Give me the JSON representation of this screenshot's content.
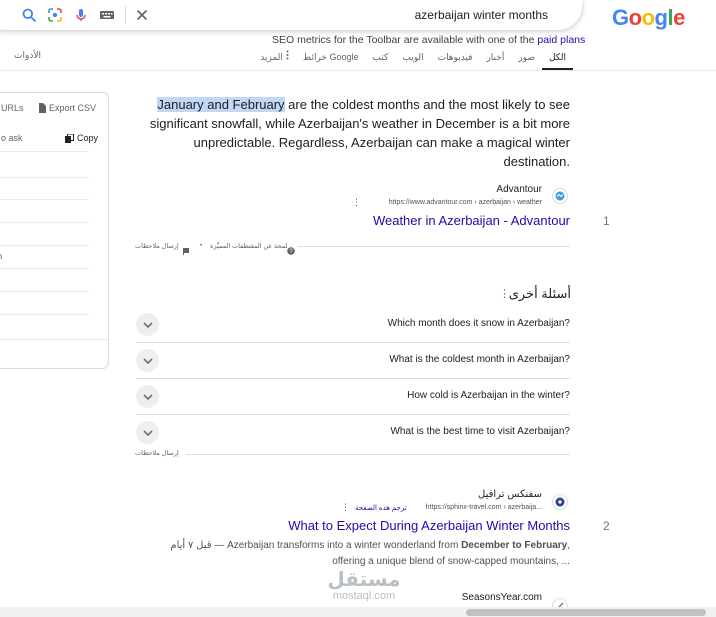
{
  "search": {
    "query": "azerbaijan winter months",
    "clear_icon": "close-icon",
    "icons": [
      "google-orb-icon",
      "search-icon",
      "lens-icon",
      "mic-icon",
      "keyboard-icon"
    ]
  },
  "logo": "Google",
  "toolbar_note": {
    "text": "SEO metrics for the Toolbar are available with one of the",
    "link": "paid plans"
  },
  "tabs": [
    {
      "label": "الكل",
      "active": true
    },
    {
      "label": "صور"
    },
    {
      "label": "أخبار"
    },
    {
      "label": "فيديوهات"
    },
    {
      "label": "الويب"
    },
    {
      "label": "كتب"
    },
    {
      "label": "خرائط Google"
    },
    {
      "label": "المزيد"
    }
  ],
  "tools_label": "الأدوات",
  "side_panel": {
    "urls_label": "URLs",
    "export_label": "Export CSV",
    "ask_label": "o ask",
    "copy_label": "Copy",
    "nth_text": "nth"
  },
  "featured": {
    "snippet_highlight": "January and February",
    "snippet_rest": " are the coldest months and the most likely to see significant snowfall, while Azerbaijan's weather in December is a bit more unpredictable. Regardless, Azerbaijan can make a magical winter destination.",
    "site_name": "Advantour",
    "url": "https://www.advantour.com › azerbaijan › weather",
    "title": "Weather in Azerbaijan - Advantour",
    "rank": "1",
    "about": "لمحة عن المقتطفات المميَّزة",
    "feedback": "إرسال ملاحظات"
  },
  "paa": {
    "title": "أسئلة أخرى",
    "questions": [
      "Which month does it snow in Azerbaijan?",
      "What is the coldest month in Azerbaijan?",
      "How cold is Azerbaijan in the winter?",
      "What is the best time to visit Azerbaijan?"
    ],
    "feedback": "إرسال ملاحظات"
  },
  "result2": {
    "site_name": "سفنكس ترافيل",
    "url": "https://sphinx-travel.com › azerbaija...",
    "translate": "ترجم هذه الصفحة",
    "title": "What to Expect During Azerbaijan Winter Months",
    "rank": "2",
    "date": "قبل ٧ أيام —",
    "desc_pre": "Azerbaijan transforms into a winter wonderland from ",
    "desc_bold": "December to February",
    "desc_post": ", offering a unique blend of snow-capped mountains, ..."
  },
  "result3": {
    "site_name": "SeasonsYear.com"
  },
  "watermark": {
    "main": "مستقل",
    "sub": "mostaql.com"
  }
}
